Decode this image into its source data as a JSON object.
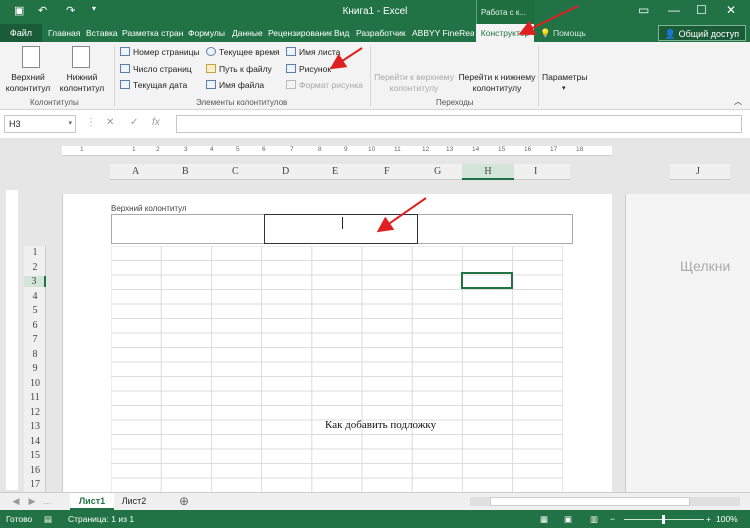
{
  "window": {
    "title": "Книга1  -  Excel",
    "context_group": "Работа с к..."
  },
  "tabs": [
    "Файл",
    "Главная",
    "Вставка",
    "Разметка стран",
    "Формулы",
    "Данные",
    "Рецензирование",
    "Вид",
    "Разработчик",
    "ABBYY FineReader",
    "Конструктор"
  ],
  "help": "Помощь",
  "share": "Общий доступ",
  "ribbon": {
    "header_btn": "Верхний колонтитул",
    "footer_btn": "Нижний колонтитул",
    "group1": "Колонтитулы",
    "items": {
      "page_number": "Номер страницы",
      "page_count": "Число страниц",
      "current_date": "Текущая дата",
      "current_time": "Текущее время",
      "file_path": "Путь к файлу",
      "file_name": "Имя файла",
      "sheet_name": "Имя листа",
      "picture": "Рисунок",
      "picture_format": "Формат рисунка"
    },
    "group2": "Элементы колонтитулов",
    "goto_header": "Перейти к верхнему колонтитулу",
    "goto_footer": "Перейти к нижнему колонтитулу",
    "group3": "Переходы",
    "params": "Параметры"
  },
  "formula": {
    "namebox": "H3",
    "value": ""
  },
  "columns": [
    "A",
    "B",
    "C",
    "D",
    "E",
    "F",
    "G",
    "H",
    "I",
    "J"
  ],
  "rows": [
    "1",
    "2",
    "3",
    "4",
    "5",
    "6",
    "7",
    "8",
    "9",
    "10",
    "11",
    "12",
    "13",
    "14",
    "15",
    "16",
    "17"
  ],
  "page": {
    "header_label": "Верхний колонтитул",
    "watermark": "Как добавить подложку",
    "next_page": "Щелкни"
  },
  "sheets": [
    "Лист1",
    "Лист2"
  ],
  "status": {
    "ready": "Готово",
    "page": "Страница: 1 из 1",
    "zoom": "100%"
  }
}
